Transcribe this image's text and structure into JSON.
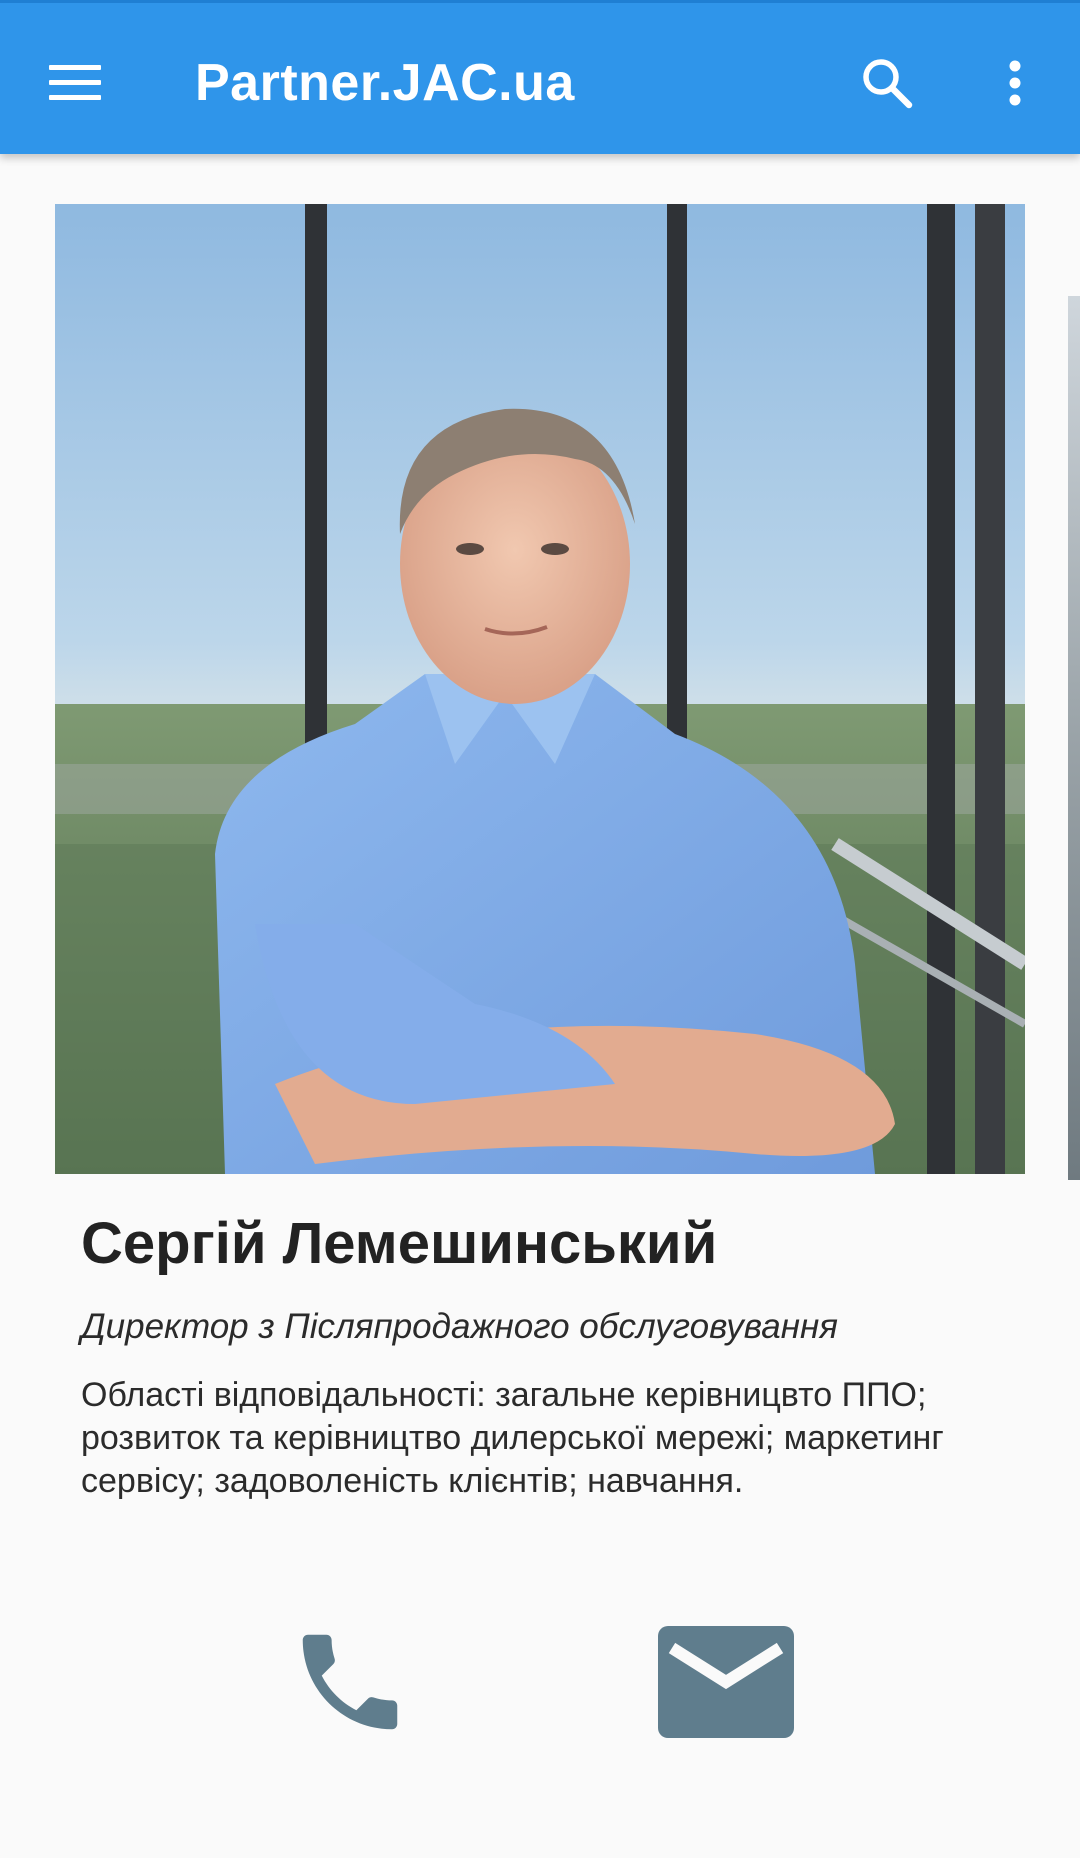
{
  "appbar": {
    "title": "Partner.JAC.ua",
    "menu_icon": "menu-icon",
    "search_icon": "search-icon",
    "more_icon": "more-vert-icon",
    "color": "#2f95ea"
  },
  "profile": {
    "photo_alt": "Сергій Лемешинський",
    "name": "Сергій Лемешинський",
    "position": "Директор з Післяпродажного обслуговування",
    "description": "Області відповідальності: загальне керівницвто ППО; розвиток та керівництво дилерської мережі; маркетинг сервісу; задоволеність клієнтів; навчання."
  },
  "actions": {
    "phone_icon": "phone-icon",
    "email_icon": "email-icon",
    "icon_color": "#5f7d8d"
  }
}
